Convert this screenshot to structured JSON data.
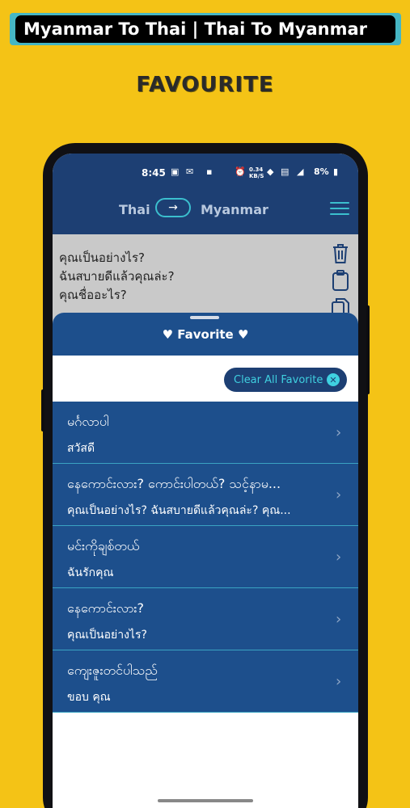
{
  "banner": {
    "title": "Myanmar To Thai | Thai To Myanmar"
  },
  "heading": "FAVOURITE",
  "status": {
    "time": "8:45",
    "speed": "0.34 KB/S",
    "battery": "8%"
  },
  "appbar": {
    "from_lang": "Thai",
    "to_lang": "Myanmar",
    "swap_icon": "→"
  },
  "input_text": {
    "line1": "คุณเป็นอย่างไร?",
    "line2": "ฉันสบายดีแล้วคุณล่ะ?",
    "line3": "คุณชื่ออะไร?"
  },
  "sheet": {
    "title": "♥ Favorite ♥",
    "clear_label": "Clear All Favorite",
    "clear_icon": "✕"
  },
  "favorites": [
    {
      "myanmar": "မင်္ဂလာပါ",
      "thai": "สวัสดี"
    },
    {
      "myanmar": "နေကောင်းလား? ကောင်းပါတယ်? သင့်နာမ...",
      "thai": "คุณเป็นอย่างไร? ฉันสบายดีแล้วคุณล่ะ? คุณ..."
    },
    {
      "myanmar": "မင်းကိုချစ်တယ်",
      "thai": "ฉันรักคุณ"
    },
    {
      "myanmar": "နေကောင်းလား?",
      "thai": "คุณเป็นอย่างไร?"
    },
    {
      "myanmar": "ကျေးဇူးတင်ပါသည်",
      "thai": "ขอบ คุณ"
    }
  ],
  "colors": {
    "background": "#f4c316",
    "primary": "#1d3f73",
    "accent": "#3bbfce"
  }
}
